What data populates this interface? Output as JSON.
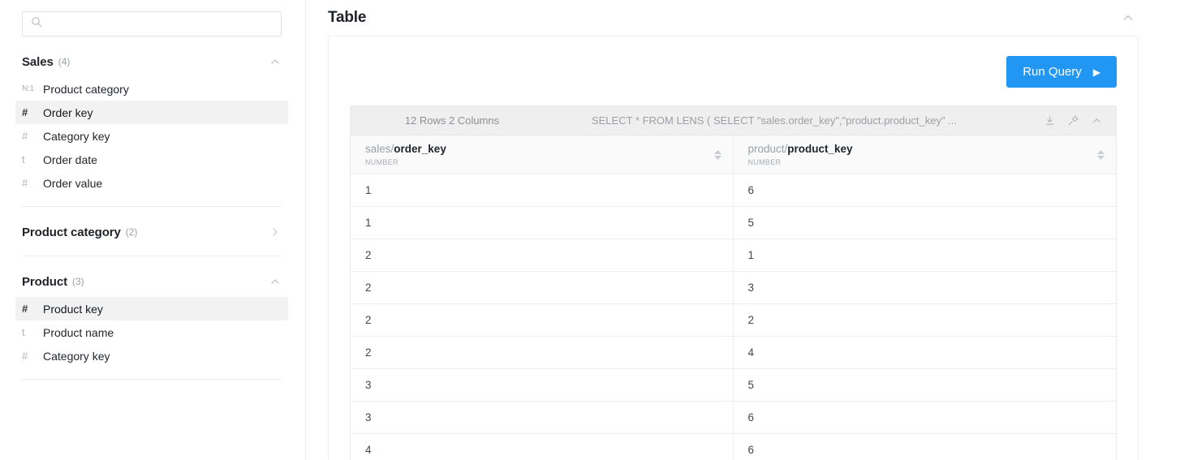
{
  "sidebar": {
    "search": {
      "value": "",
      "placeholder": "",
      "icon": "search-icon"
    },
    "sections": [
      {
        "title": "Sales",
        "count": "(4)",
        "expanded": true,
        "chevron": "chevron-up-icon",
        "fields": [
          {
            "icon": "N:1",
            "icon_name": "relation-icon",
            "label": "Product category",
            "selected": false
          },
          {
            "icon": "#",
            "icon_name": "number-icon",
            "label": "Order key",
            "selected": true
          },
          {
            "icon": "#",
            "icon_name": "number-icon",
            "label": "Category key",
            "selected": false
          },
          {
            "icon": "t",
            "icon_name": "text-icon",
            "label": "Order date",
            "selected": false
          },
          {
            "icon": "#",
            "icon_name": "number-icon",
            "label": "Order value",
            "selected": false
          }
        ]
      },
      {
        "title": "Product category",
        "count": "(2)",
        "expanded": false,
        "chevron": "chevron-right-icon",
        "fields": []
      },
      {
        "title": "Product",
        "count": "(3)",
        "expanded": true,
        "chevron": "chevron-up-icon",
        "fields": [
          {
            "icon": "#",
            "icon_name": "number-icon",
            "label": "Product key",
            "selected": true
          },
          {
            "icon": "t",
            "icon_name": "text-icon",
            "label": "Product name",
            "selected": false
          },
          {
            "icon": "#",
            "icon_name": "number-icon",
            "label": "Category key",
            "selected": false
          }
        ]
      }
    ]
  },
  "main": {
    "panel_title": "Table",
    "panel_collapse_icon": "chevron-up-icon",
    "run_query_label": "Run Query",
    "run_query_icon": "play-icon",
    "accent_color": "#2196f3",
    "grid": {
      "rows_columns_label": "12 Rows 2 Columns",
      "sql": "SELECT * FROM LENS ( SELECT \"sales.order_key\",\"product.product_key\" ...",
      "toolbar_icons": [
        "download-icon",
        "pin-icon",
        "chevron-up-icon"
      ],
      "columns": [
        {
          "namespace": "sales/",
          "field": "order_key",
          "type": "NUMBER",
          "sort_icon": "sort-arrows-icon"
        },
        {
          "namespace": "product/",
          "field": "product_key",
          "type": "NUMBER",
          "sort_icon": "sort-arrows-icon"
        }
      ],
      "rows": [
        [
          "1",
          "6"
        ],
        [
          "1",
          "5"
        ],
        [
          "2",
          "1"
        ],
        [
          "2",
          "3"
        ],
        [
          "2",
          "2"
        ],
        [
          "2",
          "4"
        ],
        [
          "3",
          "5"
        ],
        [
          "3",
          "6"
        ],
        [
          "4",
          "6"
        ]
      ]
    }
  }
}
